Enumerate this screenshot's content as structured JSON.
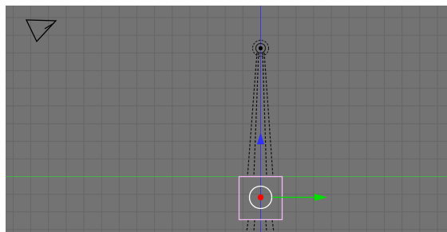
{
  "viewport": {
    "view": "top",
    "background_color": "#737373",
    "grid_color": "#666666",
    "x_axis_color": "#4cb04c",
    "y_axis_color": "#3b3bd6",
    "selection_color": "#f2b8f2",
    "active_dot_color": "#ff0000",
    "manipulator": {
      "x_arrow_color": "#00e000",
      "y_arrow_color": "#2f2fff"
    }
  },
  "icons": {
    "view_cone": "camera-view-icon",
    "lamp": "lamp-icon",
    "manipulator": "transform-manipulator-icon"
  }
}
